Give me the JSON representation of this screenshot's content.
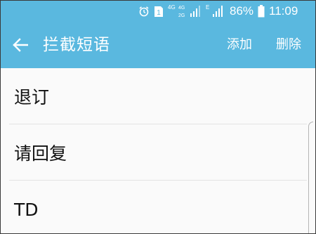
{
  "status_bar": {
    "net_type_1": "4G",
    "net_type_2": "4G",
    "net_type_3": "2G",
    "edge_indicator": "E",
    "battery_percent": "86%",
    "time": "11:09",
    "icons": [
      "alarm-icon",
      "sim-1-icon",
      "signal-4g-icon",
      "signal-icon",
      "battery-icon"
    ]
  },
  "app_bar": {
    "title": "拦截短语",
    "back_icon": "arrow-left-icon",
    "add_label": "添加",
    "delete_label": "删除",
    "background": "#5ab8df"
  },
  "phrases": [
    {
      "label": "退订"
    },
    {
      "label": "请回复"
    },
    {
      "label": "TD"
    }
  ]
}
